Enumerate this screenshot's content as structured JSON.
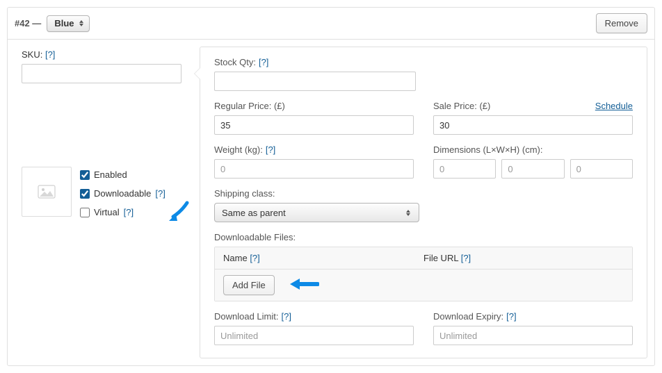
{
  "header": {
    "variation_id": "#42 —",
    "attribute_selected": "Blue",
    "remove_label": "Remove"
  },
  "side": {
    "sku_label": "SKU:",
    "help": "[?]",
    "checks": {
      "enabled": "Enabled",
      "downloadable": "Downloadable",
      "virtual": "Virtual"
    }
  },
  "main": {
    "stock_qty_label": "Stock Qty:",
    "regular_price_label": "Regular Price: (£)",
    "regular_price_value": "35",
    "sale_price_label": "Sale Price: (£)",
    "sale_price_value": "30",
    "schedule_label": "Schedule",
    "weight_label": "Weight (kg):",
    "weight_placeholder": "0",
    "dimensions_label": "Dimensions (L×W×H) (cm):",
    "dim_placeholder": "0",
    "shipping_class_label": "Shipping class:",
    "shipping_class_value": "Same as parent",
    "downloadable_files_label": "Downloadable Files:",
    "files_head_name": "Name",
    "files_head_url": "File URL",
    "add_file_label": "Add File",
    "download_limit_label": "Download Limit:",
    "download_limit_placeholder": "Unlimited",
    "download_expiry_label": "Download Expiry:",
    "download_expiry_placeholder": "Unlimited",
    "help": "[?]"
  },
  "arrow_color": "#0d8ae6"
}
